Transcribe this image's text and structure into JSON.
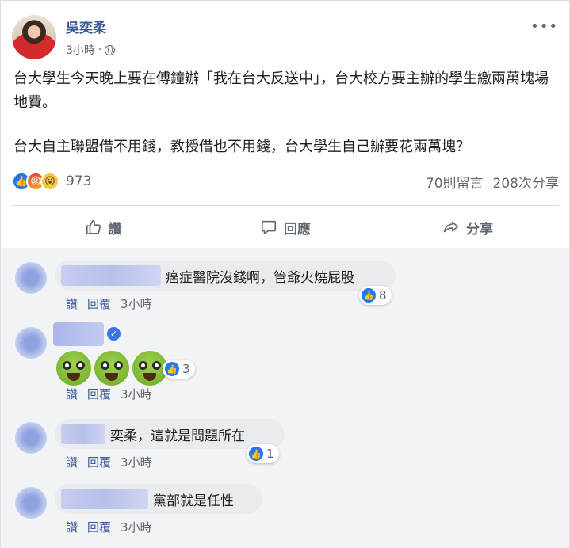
{
  "post": {
    "author": "吳奕柔",
    "time": "3小時",
    "more": "•••",
    "paragraphs": [
      "台大學生今天晚上要在傅鐘辦「我在台大反送中」，台大校方要主辦的學生繳兩萬塊場地費。",
      "台大自主聯盟借不用錢，教授借也不用錢，台大學生自己辦要花兩萬塊？"
    ],
    "reaction_count": "973",
    "comment_count": "70則留言",
    "share_count": "208次分享",
    "reactions": [
      "like-icon",
      "angry-icon",
      "wow-icon"
    ]
  },
  "actions": {
    "like": "讚",
    "comment": "回應",
    "share": "分享"
  },
  "comments": [
    {
      "text": "癌症醫院沒錢啊，管爺火燒屁股",
      "like": "讚",
      "reply": "回覆",
      "time": "3小時",
      "likes": "8"
    },
    {
      "text": "",
      "like": "讚",
      "reply": "回覆",
      "time": "3小時",
      "likes": "3",
      "emoji": "nauseated-face-icon"
    },
    {
      "text": "奕柔，這就是問題所在",
      "like": "讚",
      "reply": "回覆",
      "time": "3小時",
      "likes": "1"
    },
    {
      "text": "黨部就是任性",
      "like": "讚",
      "reply": "回覆",
      "time": "3小時"
    }
  ],
  "colors": {
    "link": "#385898",
    "muted": "#606770",
    "like": "#2078f4"
  }
}
